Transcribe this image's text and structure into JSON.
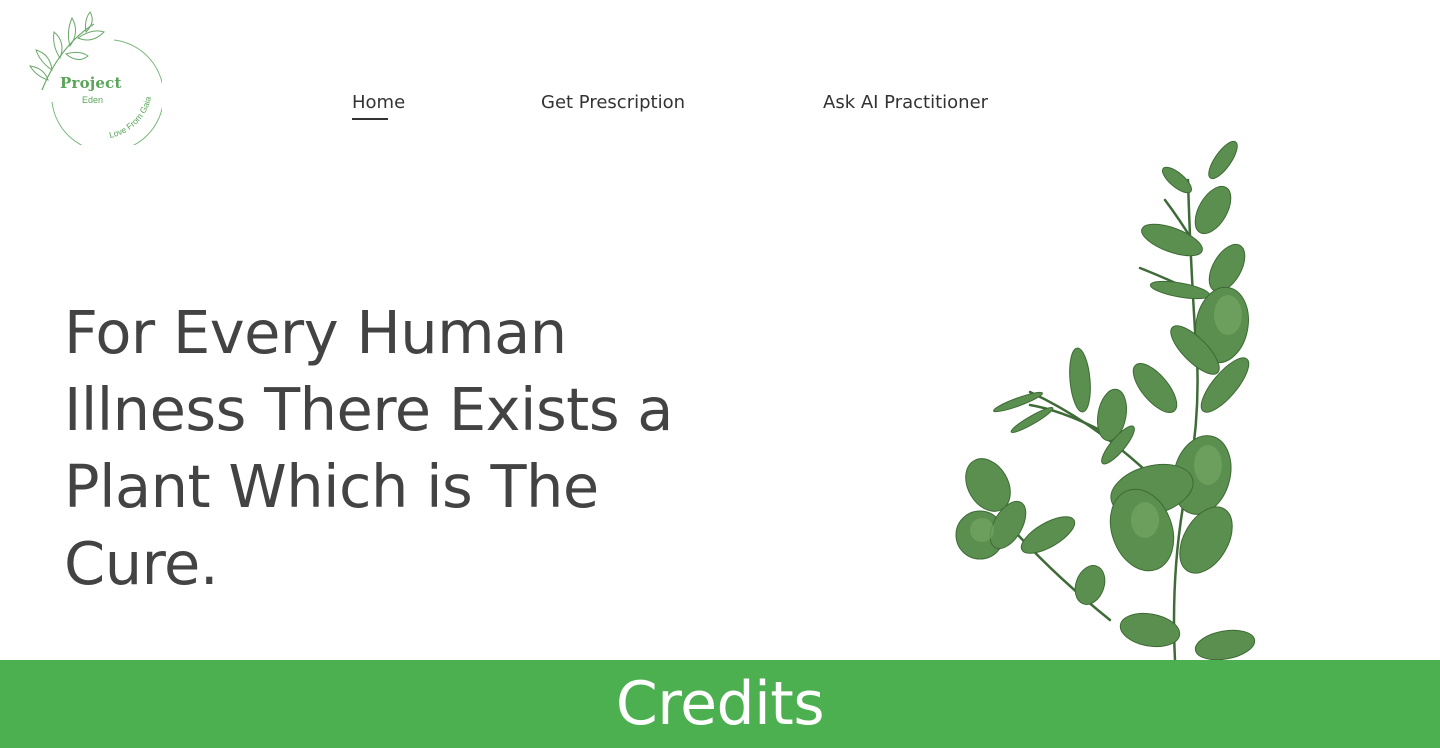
{
  "logo": {
    "title": "Project",
    "subtitle": "Eden",
    "tagline": "Love From Gaia"
  },
  "nav": {
    "items": [
      {
        "label": "Home",
        "active": true
      },
      {
        "label": "Get Prescription",
        "active": false
      },
      {
        "label": "Ask AI Practitioner",
        "active": false
      }
    ]
  },
  "hero": {
    "lines": [
      "For Every Human",
      "Illness There Exists a",
      "Plant Which is The",
      "Cure."
    ]
  },
  "footer": {
    "label": "Credits"
  },
  "colors": {
    "accent": "#4caf50",
    "logo_green": "#5aa55a",
    "text": "#434343",
    "leaf": "#4f8a44"
  },
  "icons": {
    "logo": "leaf-branch-icon",
    "plant": "eucalyptus-branch-image"
  }
}
